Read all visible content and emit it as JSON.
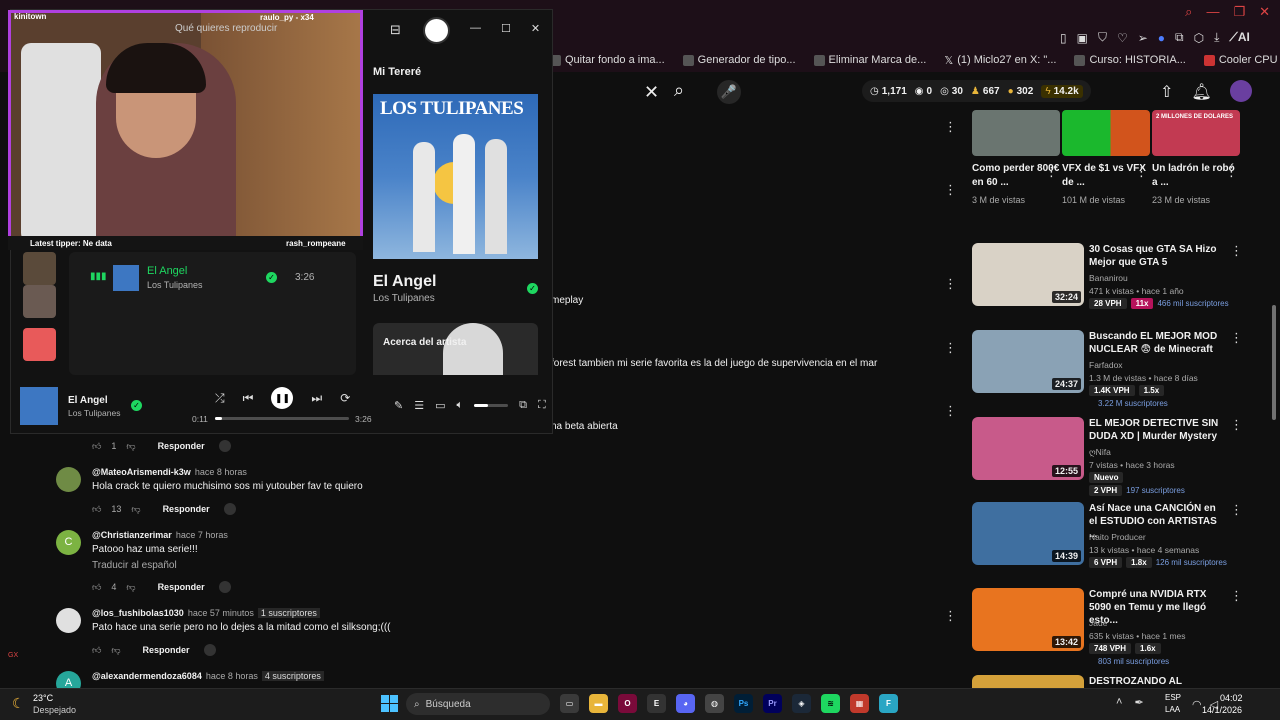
{
  "browser": {
    "bookmarks": [
      "Quitar fondo a ima...",
      "Generador de tipo...",
      "Eliminar Marca de...",
      "(1) Miclo27 en X: \"...",
      "Curso: HISTORIA...",
      "Cooler CPU Aigo..."
    ],
    "ext_label": "AI",
    "gx_label": "GX"
  },
  "youtube": {
    "stats": {
      "a": "1,171",
      "b": "0",
      "c": "30",
      "d": "667",
      "e": "302",
      "f": "14.2k"
    },
    "comments": [
      {
        "user": "@MateoArismendi-k3w",
        "time": "hace 8 horas",
        "badge": "",
        "text": "Hola crack te quiero muchisimo sos mi yutouber fav te quiero",
        "likes": "13",
        "reply": "Responder",
        "avatar": "",
        "translate": ""
      },
      {
        "user": "@Christianzerimar",
        "time": "hace 7 horas",
        "badge": "",
        "text": "Patooo haz uma serie!!!",
        "likes": "4",
        "reply": "Responder",
        "avatar": "C",
        "translate": "Traducir al español"
      },
      {
        "user": "@los_fushibolas1030",
        "time": "hace 57 minutos",
        "badge": "1 suscriptores",
        "text": "Pato hace una serie pero no lo dejes a la mitad como el silksong;(((",
        "likes": "",
        "reply": "Responder",
        "avatar": "",
        "translate": ""
      },
      {
        "user": "@alexandermendoza6084",
        "time": "hace 8 horas",
        "badge": "4 suscriptores",
        "text": "",
        "likes": "",
        "reply": "",
        "avatar": "A",
        "translate": ""
      }
    ],
    "partial_texts": {
      "p1": "meplay",
      "p2": "forest tambien mi serie favorita es la del juego de supervivencia en el mar",
      "p3": "na beta abierta"
    },
    "first_action": {
      "likes": "1",
      "reply": "Responder"
    },
    "top_videos": [
      {
        "title": "Como perder 800€ en 60 ...",
        "meta": "3 M de vistas"
      },
      {
        "title": "VFX de $1 vs VFX de ...",
        "meta": "101 M de vistas"
      },
      {
        "title": "Un ladrón le robó a ...",
        "meta": "23 M de vistas",
        "thumb_text": "2 MILLONES DE DOLARES"
      }
    ],
    "videos": [
      {
        "title": "30 Cosas que GTA SA Hizo Mejor que GTA 5",
        "channel": "Bananirou",
        "meta": "471 k vistas • hace 1 año",
        "duration": "32:24",
        "vph": "28 VPH",
        "mult": "11x",
        "subs": "466 mil suscriptores",
        "thumb": "#d9d2c6"
      },
      {
        "title": "Buscando EL MEJOR MOD NUCLEAR 😨 de Minecraft",
        "channel": "Farfadox",
        "meta": "1.3 M de vistas • hace 8 días",
        "duration": "24:37",
        "vph": "1.4K VPH",
        "mult": "1.5x",
        "subs": "3.22 M suscriptores",
        "thumb": "#8aa2b5"
      },
      {
        "title": "EL MEJOR DETECTIVE SIN DUDA XD | Murder Mystery",
        "channel": "ღNifa",
        "meta": "7 vistas • hace 3 horas",
        "duration": "12:55",
        "vph": "2 VPH",
        "mult": "",
        "subs": "197 suscriptores",
        "new_badge": "Nuevo",
        "thumb": "#c85a8a"
      },
      {
        "title": "Así Nace una CANCIÓN en el ESTUDIO con ARTISTAS ...",
        "channel": "Naito Producer",
        "meta": "13 k vistas • hace 4 semanas",
        "duration": "14:39",
        "vph": "6 VPH",
        "mult": "1.8x",
        "subs": "126 mil suscriptores",
        "thumb": "#3f6fa0"
      },
      {
        "title": "Compré una NVIDIA RTX 5090 en Temu y me llegó esto...",
        "channel": "Jade",
        "meta": "635 k vistas • hace 1 mes",
        "duration": "13:42",
        "vph": "748 VPH",
        "mult": "1.6x",
        "subs": "803 mil suscriptores",
        "thumb": "#e8741f"
      },
      {
        "title": "DESTROZANDO AL AKINATOR |",
        "channel": "",
        "meta": "",
        "duration": "",
        "vph": "",
        "mult": "",
        "subs": "",
        "thumb": "#d4a13a"
      }
    ]
  },
  "spotify": {
    "search_placeholder": "Qué quieres reproducir",
    "panel_title": "Mi Tereré",
    "album_text": "LOS TULIPANES",
    "song": "El Angel",
    "artist": "Los Tulipanes",
    "about": "Acerca del artista",
    "row_duration": "3:26",
    "elapsed": "0:11",
    "total": "3:26",
    "progress": 0.053,
    "volume": 0.4
  },
  "stream_overlay": {
    "top_left": "kinitown",
    "top_right": "raulo_py - x34",
    "tipper": "Latest tipper: Ne data",
    "tipper_right": "rash_rompeane"
  },
  "taskbar": {
    "temp": "23°C",
    "weather": "Despejado",
    "search": "Búsqueda",
    "lang1": "ESP",
    "lang2": "LAA",
    "time": "04:02",
    "date": "14/1/2026"
  },
  "colors": {
    "spotify_green": "#1ed760",
    "accent_purple": "#b040e0"
  }
}
